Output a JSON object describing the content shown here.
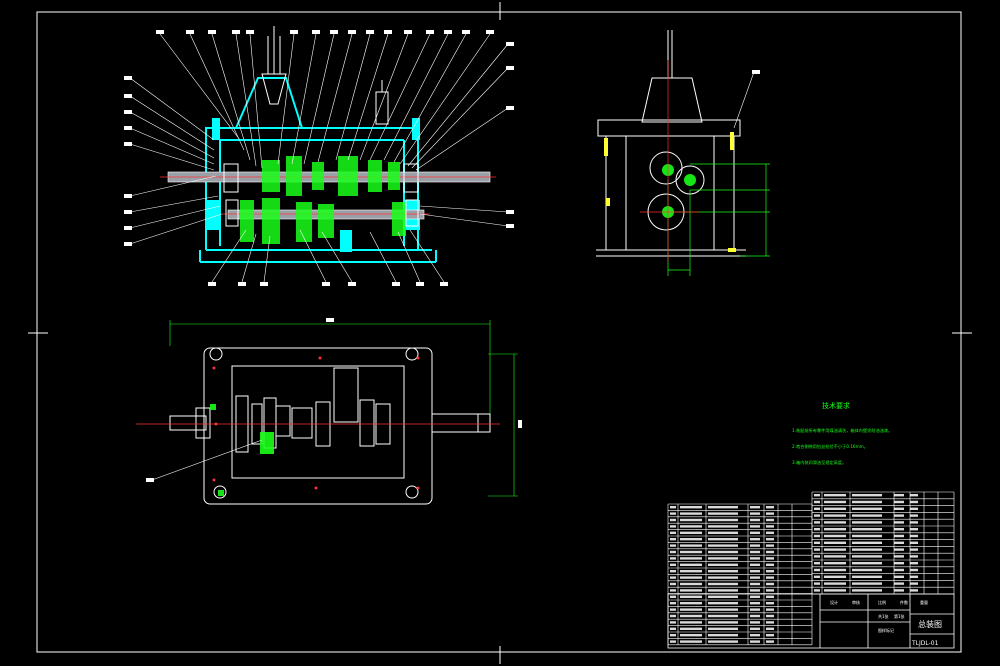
{
  "drawing": {
    "technical_requirements": {
      "title": "技术要求",
      "items": [
        "1.装配前所有零件用煤油清洗，箱体内壁涂耐油油漆。",
        "2.啮合侧隙用铅丝检验不小于0.16mm。",
        "3.箱内装润滑油至规定高度。"
      ]
    },
    "title_block": {
      "name": "总装图",
      "drawing_no": "TLJDL-01",
      "labels": [
        "设计",
        "审核",
        "比例",
        "件数",
        "重量",
        "共1张",
        "第1张",
        "图样标记"
      ]
    },
    "colors": {
      "background": "#000000",
      "frame": "#ffffff",
      "housing": "#00ffff",
      "gears": "#19ff19",
      "centerline": "#ff3030",
      "shaft": "#9aa0a8",
      "bolt": "#ffff33"
    }
  }
}
